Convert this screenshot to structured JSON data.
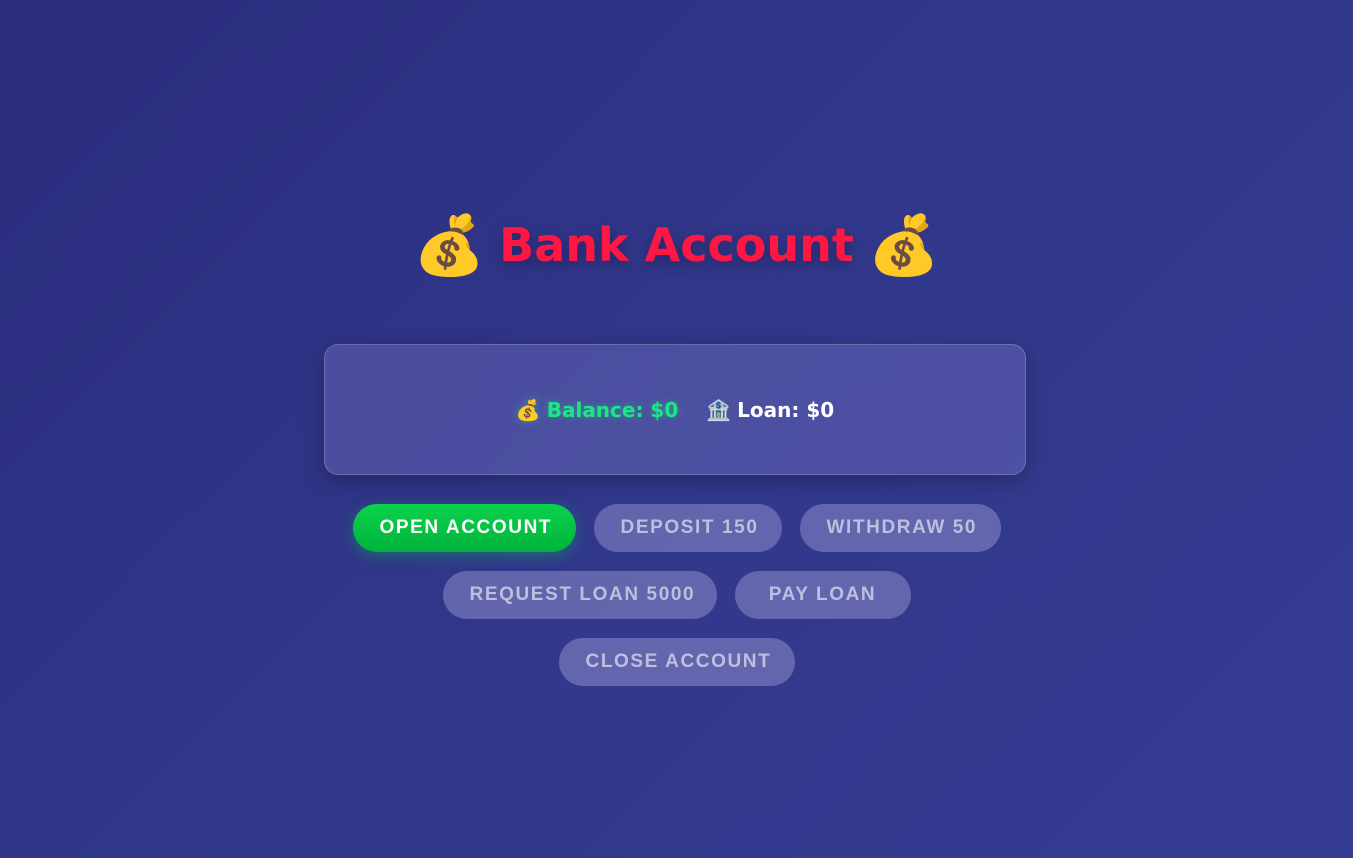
{
  "header": {
    "title": "Bank Account",
    "emoji_left": "💰",
    "emoji_right": "💰"
  },
  "status": {
    "balance_icon": "💰",
    "balance_text": "Balance: $0",
    "loan_icon": "🏦",
    "loan_text": "Loan: $0"
  },
  "actions": {
    "open_account": "OPEN ACCOUNT",
    "deposit": "DEPOSIT 150",
    "withdraw": "WITHDRAW 50",
    "request_loan": "REQUEST LOAN 5000",
    "pay_loan": "PAY LOAN",
    "close_account": "CLOSE ACCOUNT"
  },
  "colors": {
    "title": "#ff1744",
    "balance": "#19e884",
    "active_button": "#00c853"
  }
}
